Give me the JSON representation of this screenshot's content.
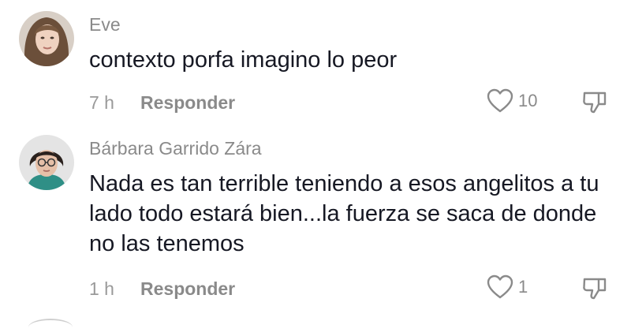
{
  "comments": [
    {
      "username": "Eve",
      "text": "contexto porfa imagino lo peor",
      "time": "7 h",
      "reply_label": "Responder",
      "like_count": "10",
      "avatar_icon": "avatar-photo-woman-blonde"
    },
    {
      "username": "Bárbara Garrido Zára",
      "text": "Nada es tan terrible teniendo a esos angelitos a tu lado todo estará bien...la fuerza se saca de donde no las tenemos",
      "time": "1 h",
      "reply_label": "Responder",
      "like_count": "1",
      "avatar_icon": "avatar-photo-woman-glasses"
    }
  ],
  "icons": {
    "like": "heart-outline-icon",
    "dislike": "thumbs-down-outline-icon"
  },
  "colors": {
    "text": "#161823",
    "meta": "#8a8a8a",
    "background": "#ffffff"
  }
}
